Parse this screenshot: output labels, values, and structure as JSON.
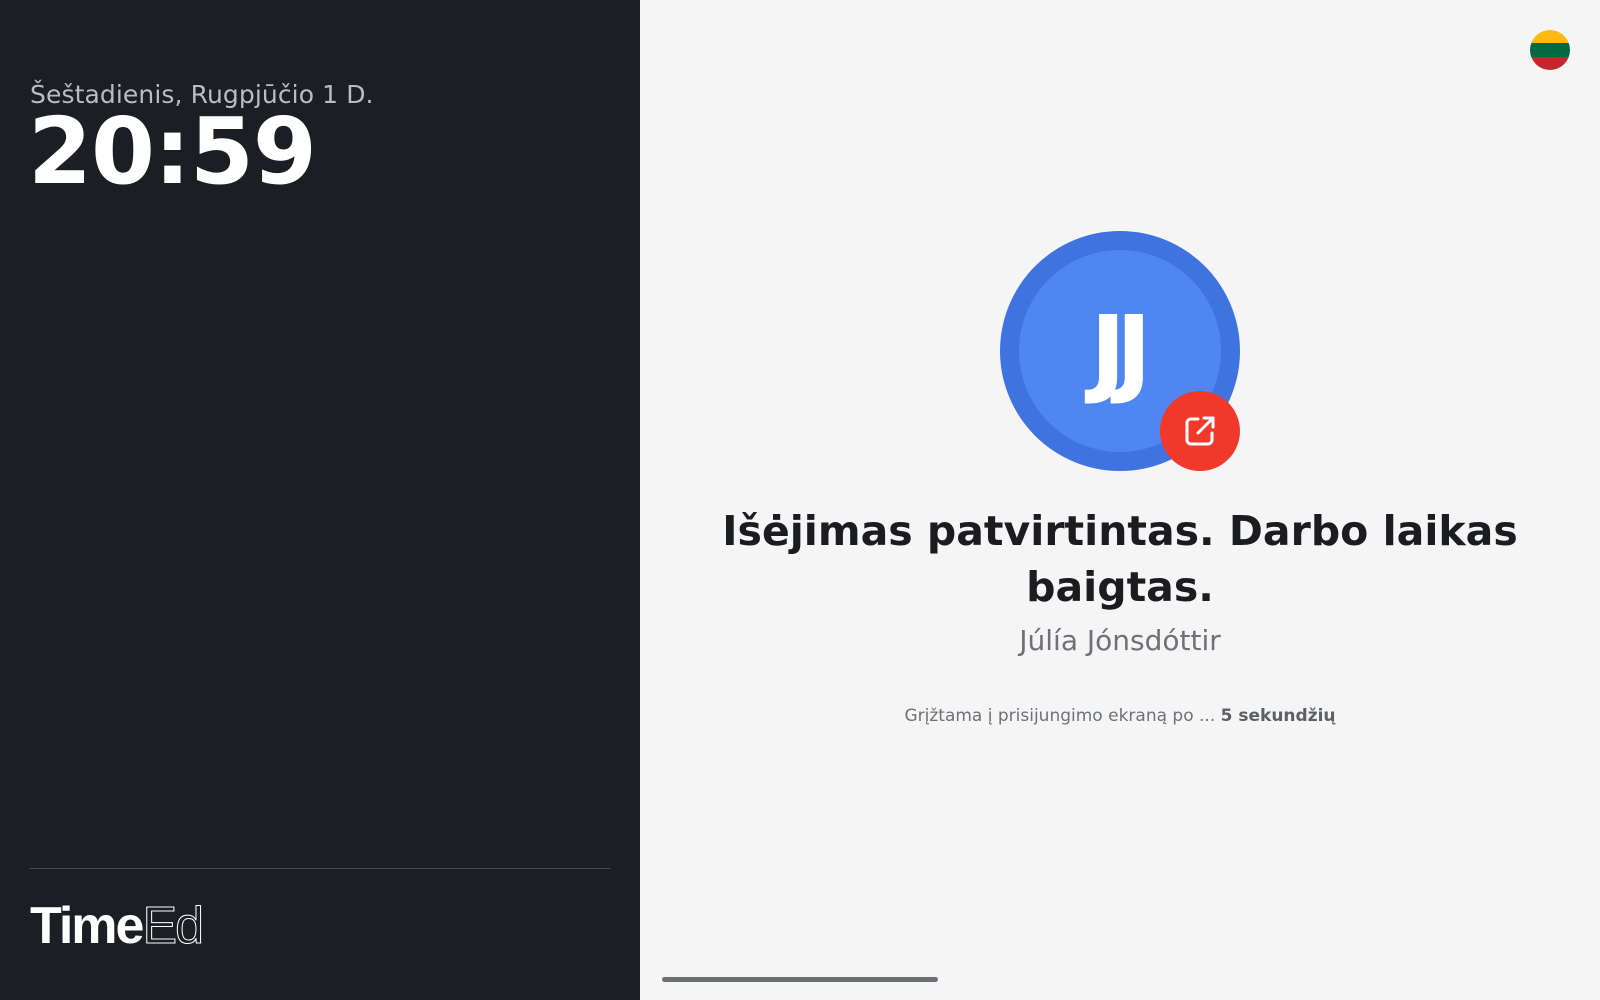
{
  "clock": {
    "date": "Šeštadienis, Rugpjūčio 1 D.",
    "time": "20:59"
  },
  "brand": {
    "logo_bold": "Time",
    "logo_light": "Ed"
  },
  "language": {
    "flag_icon": "lithuania-flag-icon",
    "flag_colors": [
      "#fdb913",
      "#006a44",
      "#c1272d"
    ]
  },
  "result": {
    "avatar_initials": "JJ",
    "avatar_color": "#4f86f2",
    "badge_icon": "exit-arrow-icon",
    "badge_color": "#f0392b",
    "headline": "Išėjimas patvirtintas. Darbo laikas baigtas.",
    "person_name": "Júlía Jónsdóttir",
    "redirect_text": "Grįžtama į prisijungimo ekraną po ...",
    "redirect_countdown": "5 sekundžių"
  }
}
